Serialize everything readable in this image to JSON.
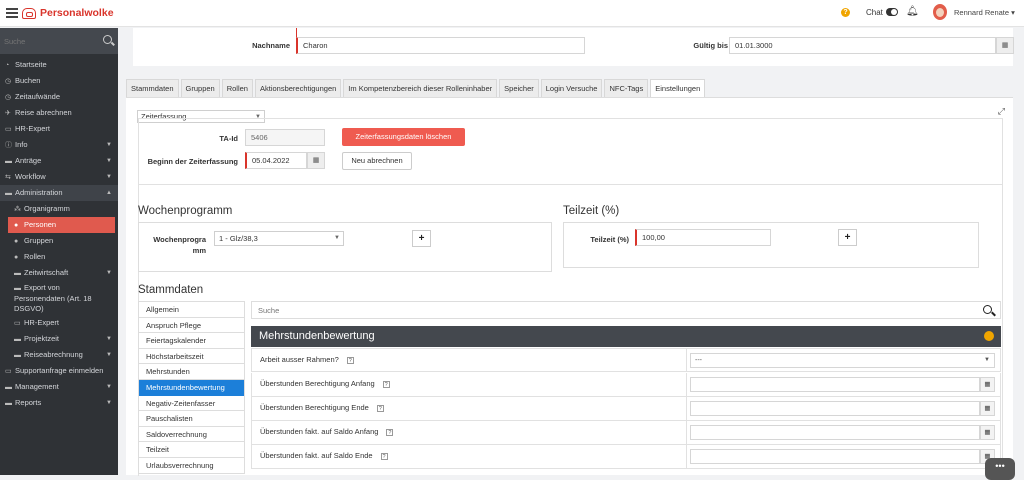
{
  "app": {
    "name": "Personalwolke",
    "brand_color": "#d9342b"
  },
  "topbar": {
    "help_icon": "?",
    "chat_label": "Chat",
    "user_name": "Rennard Renate"
  },
  "sidebar": {
    "search_placeholder": "Suche",
    "items": [
      {
        "label": "Startseite",
        "icon": "gauge-icon"
      },
      {
        "label": "Buchen",
        "icon": "clock-icon"
      },
      {
        "label": "Zeitaufwände",
        "icon": "clock-icon"
      },
      {
        "label": "Reise abrechnen",
        "icon": "plane-icon"
      },
      {
        "label": "HR-Expert",
        "icon": "monitor-icon"
      },
      {
        "label": "Info",
        "icon": "info-icon"
      },
      {
        "label": "Anträge",
        "icon": "folder-icon"
      },
      {
        "label": "Workflow",
        "icon": "workflow-icon"
      },
      {
        "label": "Administration",
        "icon": "folder-icon"
      },
      {
        "label": "Organigramm",
        "icon": "sitemap-icon"
      },
      {
        "label": "Personen",
        "icon": "user-icon"
      },
      {
        "label": "Gruppen",
        "icon": "users-icon"
      },
      {
        "label": "Rollen",
        "icon": "user-icon"
      },
      {
        "label": "Zeitwirtschaft",
        "icon": "folder-icon"
      },
      {
        "label": "Export von Personendaten (Art. 18 DSGVO)",
        "icon": "folder-icon"
      },
      {
        "label": "HR-Expert",
        "icon": "monitor-icon"
      },
      {
        "label": "Projektzeit",
        "icon": "folder-icon"
      },
      {
        "label": "Reiseabrechnung",
        "icon": "folder-icon"
      },
      {
        "label": "Supportanfrage einmelden",
        "icon": "monitor-icon"
      },
      {
        "label": "Management",
        "icon": "folder-icon"
      },
      {
        "label": "Reports",
        "icon": "folder-icon"
      }
    ]
  },
  "person": {
    "nachname_label": "Nachname",
    "nachname_value": "Charon",
    "gueltig_label": "Gültig bis",
    "gueltig_value": "01.01.3000"
  },
  "tabs": [
    "Stammdaten",
    "Gruppen",
    "Rollen",
    "Aktionsberechtigungen",
    "Im Kompetenzbereich dieser Rolleninhaber",
    "Speicher",
    "Login Versuche",
    "NFC-Tags",
    "Einstellungen"
  ],
  "settings": {
    "category_select": "Zeiterfassung",
    "ta_id_label": "TA-Id",
    "ta_id_value": "5406",
    "delete_button": "Zeiterfassungsdaten löschen",
    "beginn_label": "Beginn der Zeiterfassung",
    "beginn_value": "05.04.2022",
    "recalc_button": "Neu abrechnen",
    "wochen_title": "Wochenprogramm",
    "wochen_label_1": "Wochenprogra",
    "wochen_label_2": "mm",
    "wochen_value": "1 - Glz/38,3",
    "teilzeit_title": "Teilzeit (%)",
    "teilzeit_label": "Teilzeit (%)",
    "teilzeit_value": "100,00",
    "plus": "+",
    "stamm_title": "Stammdaten",
    "stamm_items": [
      "Allgemein",
      "Anspruch Pflege",
      "Feiertagskalender",
      "Höchstarbeitszeit",
      "Mehrstunden",
      "Mehrstundenbewertung",
      "Negativ-Zeitenfasser",
      "Pauschalisten",
      "Saldoverrechnung",
      "Teilzeit",
      "Urlaubsverrechnung"
    ],
    "search_placeholder": "Suche",
    "section_header": "Mehrstundenbewertung",
    "rows": [
      {
        "label": "Arbeit ausser Rahmen?",
        "value": "---"
      },
      {
        "label": "Überstunden Berechtigung Anfang",
        "value": ""
      },
      {
        "label": "Überstunden Berechtigung Ende",
        "value": ""
      },
      {
        "label": "Überstunden fakt. auf Saldo Anfang",
        "value": ""
      },
      {
        "label": "Überstunden fakt. auf Saldo Ende",
        "value": ""
      }
    ]
  }
}
